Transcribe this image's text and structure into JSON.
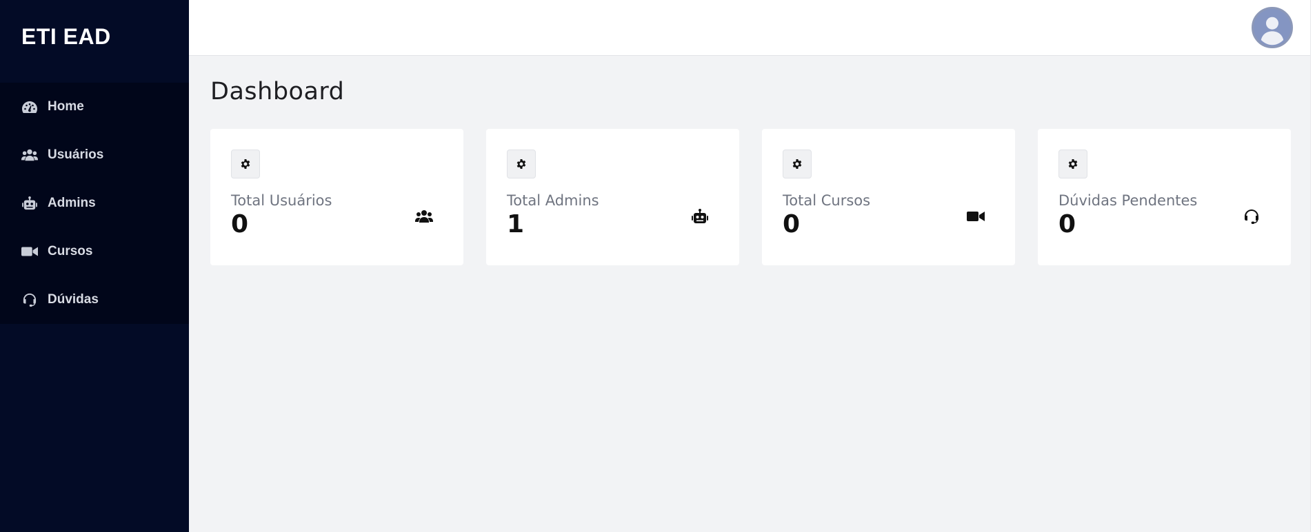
{
  "brand": {
    "name": "ETI EAD"
  },
  "sidebar": {
    "items": [
      {
        "label": "Home",
        "icon": "tachometer-icon"
      },
      {
        "label": "Usuários",
        "icon": "users-icon"
      },
      {
        "label": "Admins",
        "icon": "robot-icon"
      },
      {
        "label": "Cursos",
        "icon": "video-icon"
      },
      {
        "label": "Dúvidas",
        "icon": "headset-icon"
      }
    ]
  },
  "header": {
    "avatar": "user-avatar"
  },
  "main": {
    "title": "Dashboard",
    "cards": [
      {
        "label": "Total Usuários",
        "value": "0",
        "icon": "users-icon"
      },
      {
        "label": "Total Admins",
        "value": "1",
        "icon": "robot-icon"
      },
      {
        "label": "Total Cursos",
        "value": "0",
        "icon": "video-icon"
      },
      {
        "label": "Dúvidas Pendentes",
        "value": "0",
        "icon": "headset-icon"
      }
    ]
  },
  "colors": {
    "sidebar_bg": "#030b26",
    "nav_bg": "#01061a",
    "page_bg": "#f2f3f5",
    "card_bg": "#ffffff",
    "avatar_bg": "#8495c2"
  }
}
